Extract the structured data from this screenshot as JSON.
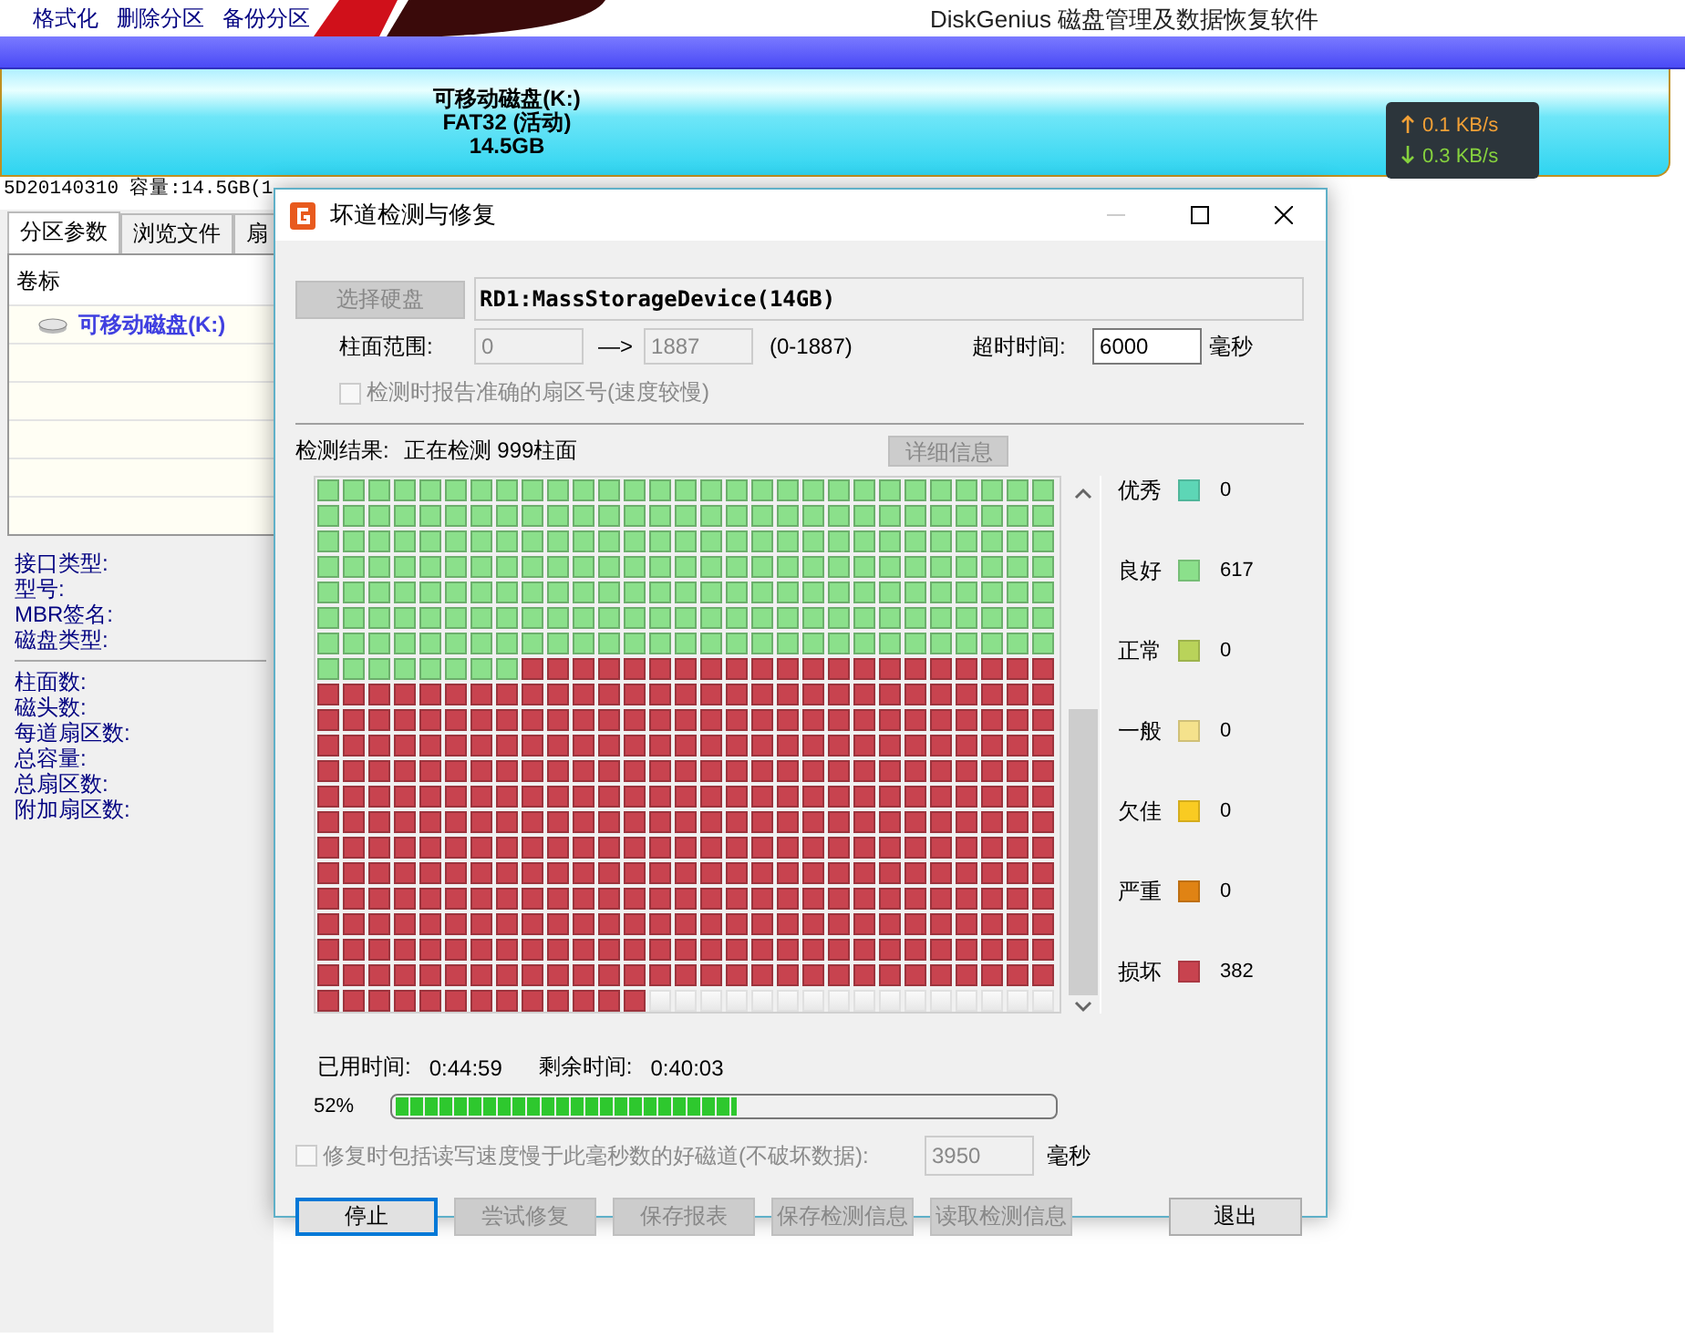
{
  "toolbar": {
    "items": [
      "格式化",
      "删除分区",
      "备份分区"
    ]
  },
  "banner": {
    "product_title": "DiskGenius 磁盘管理及数据恢复软件"
  },
  "disk_bar": {
    "name": "可移动磁盘(K:)",
    "filesystem": "FAT32 (活动)",
    "size": "14.5GB"
  },
  "network_speed": {
    "upload": "0.1 KB/s",
    "download": "0.3 KB/s"
  },
  "disk_info": [
    "5D20140310",
    "容量:14.5GB(1"
  ],
  "left_panel": {
    "tabs": [
      {
        "label": "分区参数",
        "selected": true
      },
      {
        "label": "浏览文件",
        "selected": false
      },
      {
        "label": "扇",
        "selected": false
      }
    ],
    "tree_header": "卷标",
    "tree_items": [
      {
        "label": "可移动磁盘(K:)"
      }
    ],
    "fields_group_1": [
      "接口类型:",
      "型号:",
      "MBR签名:",
      "磁盘类型:"
    ],
    "fields_group_2": [
      "柱面数:",
      "磁头数:",
      "每道扇区数:",
      "总容量:",
      "总扇区数:",
      "附加扇区数:"
    ]
  },
  "dialog": {
    "title": "坏道检测与修复",
    "select_disk_button": {
      "label": "选择硬盘",
      "disabled": true
    },
    "device": "RD1:MassStorageDevice(14GB)",
    "cylinder_range": {
      "label": "柱面范围:",
      "from": "0",
      "arrow": "—>",
      "to": "1887",
      "hint": "(0-1887)",
      "disabled": true
    },
    "timeout": {
      "label": "超时时间:",
      "value": "6000",
      "unit": "毫秒"
    },
    "report_exact_sector": {
      "label": "检测时报告准确的扇区号(速度较慢)",
      "checked": false,
      "disabled": true
    },
    "result": {
      "label": "检测结果:",
      "status": "正在检测 999柱面"
    },
    "details_button": {
      "label": "详细信息",
      "disabled": true
    },
    "sector_map": {
      "cells": [
        {
          "kind": "scanned",
          "color": "#8be08b",
          "level": 0.34647
        },
        {
          "kind": "scanned",
          "color": "#c8434f",
          "level": 0.62726
        },
        {
          "kind": "pending",
          "level": 0.02627
        }
      ]
    },
    "legend": [
      {
        "label": "优秀",
        "color": "#5dd6b6",
        "count": "0"
      },
      {
        "label": "良好",
        "color": "#8be08b",
        "count": "617"
      },
      {
        "label": "正常",
        "color": "#b9d35a",
        "count": "0"
      },
      {
        "label": "一般",
        "color": "#f5e28c",
        "count": "0"
      },
      {
        "label": "欠佳",
        "color": "#f9cb22",
        "count": "0"
      },
      {
        "label": "严重",
        "color": "#e08314",
        "count": "0"
      },
      {
        "label": "损坏",
        "color": "#c8434f",
        "count": "382"
      }
    ],
    "elapsed": {
      "label": "已用时间:",
      "value": "0:44:59"
    },
    "remaining": {
      "label": "剩余时间:",
      "value": "0:40:03"
    },
    "progress": {
      "reading": "52%",
      "level": 0.52
    },
    "repair_slow": {
      "label": "修复时包括读写速度慢于此毫秒数的好磁道(不破坏数据):",
      "checked": false,
      "disabled": true,
      "value": "3950",
      "unit": "毫秒"
    },
    "buttons": [
      {
        "label": "停止",
        "disabled": false,
        "focused": true
      },
      {
        "label": "尝试修复",
        "disabled": true,
        "focused": false
      },
      {
        "label": "保存报表",
        "disabled": true,
        "focused": false
      },
      {
        "label": "保存检测信息",
        "disabled": true,
        "focused": false
      },
      {
        "label": "读取检测信息",
        "disabled": true,
        "focused": false
      },
      {
        "label": "退出",
        "disabled": false,
        "focused": false
      }
    ]
  }
}
